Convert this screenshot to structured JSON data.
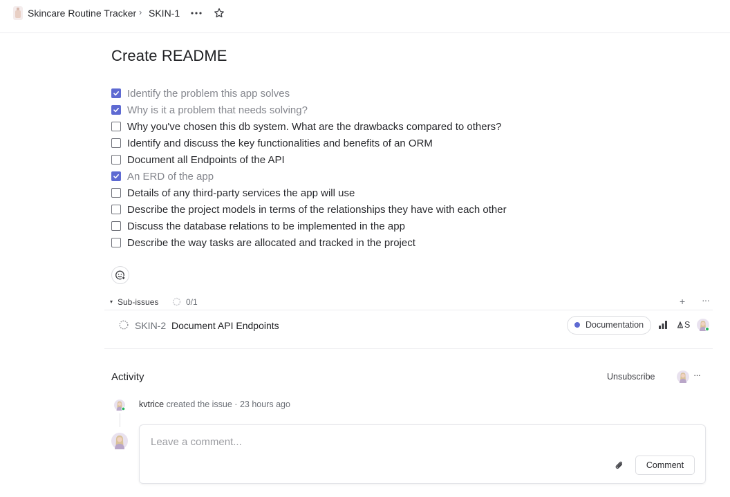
{
  "breadcrumb": {
    "project": "Skincare Routine Tracker",
    "separator": "›",
    "issue_id": "SKIN-1"
  },
  "issue": {
    "title": "Create README",
    "checklist": [
      {
        "text": "Identify the problem this app solves",
        "checked": true
      },
      {
        "text": "Why is it a problem that needs solving?",
        "checked": true
      },
      {
        "text": "Why you've chosen this db system. What are the drawbacks compared to others?",
        "checked": false
      },
      {
        "text": "Identify and discuss the key functionalities and benefits of an ORM",
        "checked": false
      },
      {
        "text": "Document all Endpoints of the API",
        "checked": false
      },
      {
        "text": "An ERD of the app",
        "checked": true
      },
      {
        "text": "Details of any third-party services the app will use",
        "checked": false
      },
      {
        "text": "Describe the project models in terms of the relationships they have with each other",
        "checked": false
      },
      {
        "text": "Discuss the database relations to be implemented in the app",
        "checked": false
      },
      {
        "text": "Describe the way tasks are allocated and tracked in the project",
        "checked": false
      }
    ]
  },
  "sub_issues": {
    "toggle": "▾",
    "label": "Sub-issues",
    "count": "0/1",
    "add": "+",
    "more": "···",
    "items": [
      {
        "id": "SKIN-2",
        "title": "Document API Endpoints",
        "label": "Documentation",
        "label_color": "#5e6ad2",
        "estimate": "S"
      }
    ]
  },
  "activity": {
    "title": "Activity",
    "unsubscribe": "Unsubscribe",
    "more": "···",
    "feed": [
      {
        "user": "kvtrice",
        "action": "created the issue",
        "separator": "·",
        "time": "23 hours ago"
      }
    ],
    "comment": {
      "placeholder": "Leave a comment...",
      "button": "Comment"
    }
  },
  "colors": {
    "accent": "#5e6ad2",
    "online": "#26b55e"
  }
}
